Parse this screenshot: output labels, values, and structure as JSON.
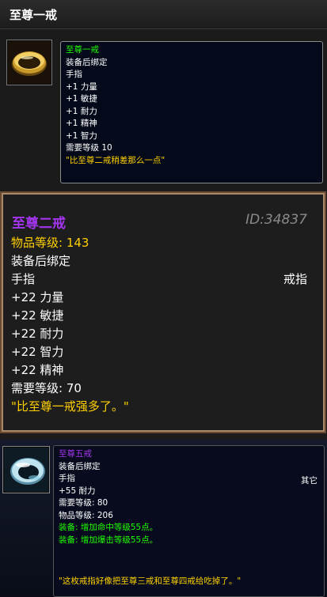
{
  "panel1": {
    "header_title": "至尊一戒",
    "icon": "gold-ring-icon",
    "tooltip": {
      "name": "至尊一戒",
      "bind": "装备后绑定",
      "slot": "手指",
      "stats": [
        "+1 力量",
        "+1 敏捷",
        "+1 耐力",
        "+1 精神",
        "+1 智力"
      ],
      "required_level": "需要等级 10",
      "flavor": "\"比至尊二戒稍差那么一点\""
    }
  },
  "panel2": {
    "name": "至尊二戒",
    "id": "ID:34837",
    "item_level_label": "物品等级:",
    "item_level_value": "143",
    "bind": "装备后绑定",
    "slot": "手指",
    "slot_type": "戒指",
    "stats": [
      "+22 力量",
      "+22 敏捷",
      "+22 耐力",
      "+22 智力",
      "+22 精神"
    ],
    "required_level": "需要等级: 70",
    "flavor": "\"比至尊一戒强多了。\""
  },
  "panel3": {
    "icon": "silver-ring-icon",
    "tooltip": {
      "name": "至尊五戒",
      "bind": "装备后绑定",
      "slot": "手指",
      "slot_type": "其它",
      "stat": "+55 耐力",
      "required_level": "需要等级: 80",
      "item_level": "物品等级: 206",
      "equip_effects": [
        "装备: 增加命中等级55点。",
        "装备: 增加爆击等级55点。"
      ],
      "flavor": "\"这枚戒指好像把至尊三戒和至尊四戒给吃掉了。\""
    }
  },
  "colors": {
    "green": "#1eff00",
    "gold": "#ffd100",
    "purple": "#a335ee",
    "panel_border": "#a88a68"
  }
}
